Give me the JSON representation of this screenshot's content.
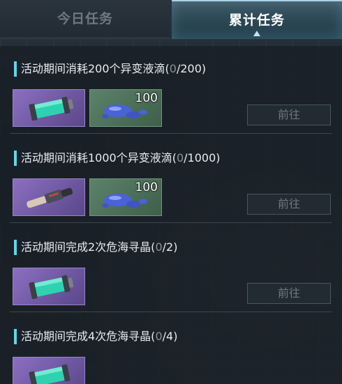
{
  "tabs": [
    {
      "label": "今日任务",
      "active": false
    },
    {
      "label": "累计任务",
      "active": true
    }
  ],
  "colors": {
    "accent": "#66d3e4",
    "active_tab": "#2a4552",
    "rare_purple": "#8b6fc0",
    "common_green": "#5c826a"
  },
  "tasks": [
    {
      "prefix": "活动期间消耗200个异变液滴(",
      "progress_done": "0",
      "progress_rest": "/200)",
      "rewards": [
        {
          "icon": "green-canister-icon",
          "rarity": "purple",
          "qty": ""
        },
        {
          "icon": "blue-liquid-droplet-icon",
          "rarity": "green",
          "qty": "100"
        }
      ],
      "button": "前往"
    },
    {
      "prefix": "活动期间消耗1000个异变液滴(",
      "progress_done": "0",
      "progress_rest": "/1000)",
      "rewards": [
        {
          "icon": "bone-handle-tool-icon",
          "rarity": "purple",
          "qty": ""
        },
        {
          "icon": "blue-liquid-droplet-icon",
          "rarity": "green",
          "qty": "100"
        }
      ],
      "button": "前往"
    },
    {
      "prefix": "活动期间完成2次危海寻晶(",
      "progress_done": "0",
      "progress_rest": "/2)",
      "rewards": [
        {
          "icon": "green-canister-icon",
          "rarity": "purple",
          "qty": ""
        }
      ],
      "button": "前往"
    },
    {
      "prefix": "活动期间完成4次危海寻晶(",
      "progress_done": "0",
      "progress_rest": "/4)",
      "rewards": [
        {
          "icon": "green-canister-icon",
          "rarity": "purple",
          "qty": ""
        }
      ],
      "button": ""
    }
  ]
}
